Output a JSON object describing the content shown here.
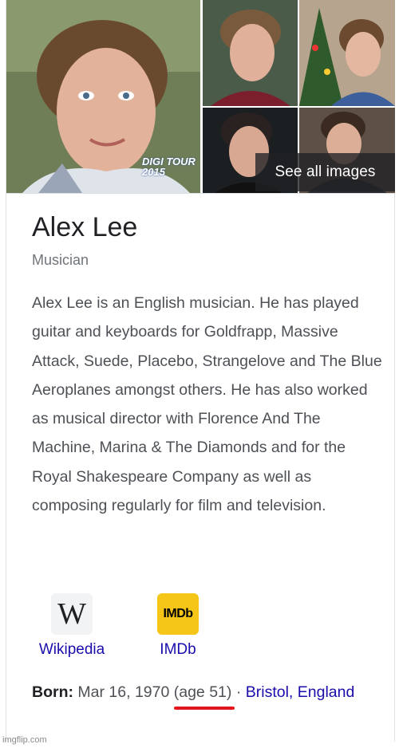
{
  "images": {
    "main": {
      "alt": "portrait",
      "overlay_text": "DIGI TOUR 2015"
    },
    "see_all_label": "See all images"
  },
  "entity": {
    "name": "Alex Lee",
    "type": "Musician",
    "description": "Alex Lee is an English musician. He has played guitar and keyboards for Goldfrapp, Massive Attack, Suede, Placebo, Strangelove and The Blue Aeroplanes amongst others. He has also worked as musical director with Florence And The Machine, Marina & The Diamonds and for the Royal Shakespeare Company as well as composing regularly for film and television."
  },
  "links": {
    "wikipedia": {
      "icon_text": "W",
      "label": "Wikipedia"
    },
    "imdb": {
      "icon_text": "IMDb",
      "label": "IMDb"
    }
  },
  "born": {
    "label": "Born:",
    "date": "Mar 16, 1970",
    "age": "(age 51)",
    "separator": "·",
    "place": "Bristol, England"
  },
  "watermark": "imgflip.com",
  "colors": {
    "link": "#1a0dab",
    "highlight": "#e3161b",
    "imdb": "#f5c518"
  }
}
